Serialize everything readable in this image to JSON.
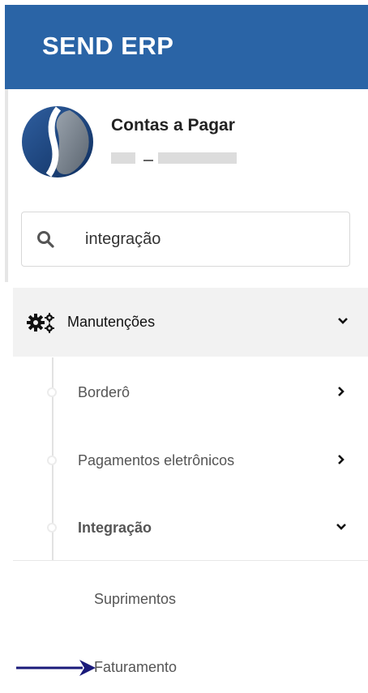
{
  "header": {
    "title": "SEND ERP",
    "color": "#2a64a6"
  },
  "profile": {
    "module_title": "Contas a Pagar",
    "logo_icon": "company-logo"
  },
  "search": {
    "value": "integração",
    "icon": "search-icon"
  },
  "menu": {
    "group": {
      "label": "Manutenções",
      "icon": "gears-icon",
      "expanded": true
    },
    "items": [
      {
        "label": "Borderô",
        "expanded": false,
        "bold": false
      },
      {
        "label": "Pagamentos eletrônicos",
        "expanded": false,
        "bold": false
      },
      {
        "label": "Integração",
        "expanded": true,
        "bold": true
      }
    ],
    "subitems": [
      {
        "label": "Suprimentos"
      },
      {
        "label": "Faturamento"
      }
    ]
  },
  "annotation": {
    "arrow_color": "#1a1a7a",
    "points_to": "Faturamento"
  }
}
